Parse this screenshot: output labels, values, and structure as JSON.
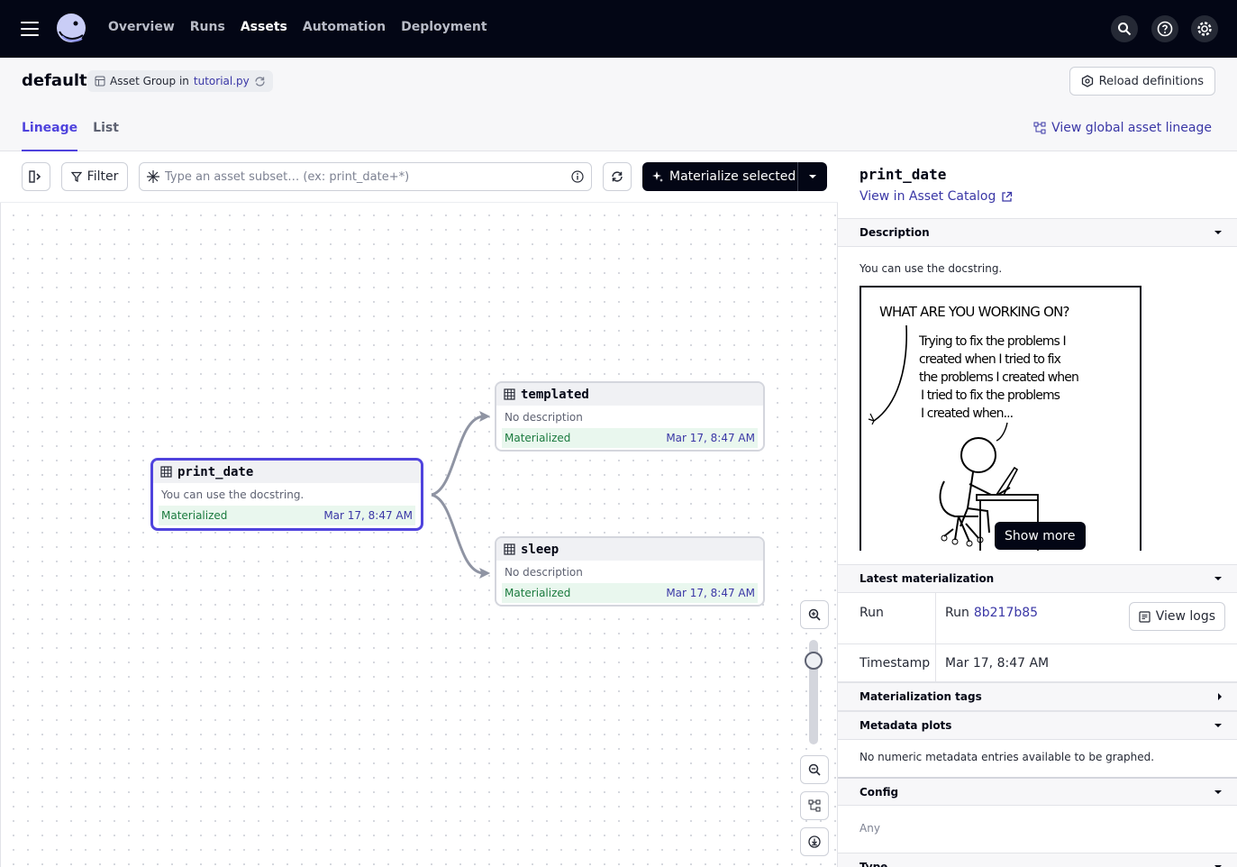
{
  "nav": {
    "links": [
      "Overview",
      "Runs",
      "Assets",
      "Automation",
      "Deployment"
    ],
    "active": "Assets",
    "icons": [
      "search-icon",
      "help-icon",
      "settings-icon"
    ]
  },
  "header": {
    "title": "default",
    "group_tag_prefix": "Asset Group in",
    "group_tag_file": "tutorial.py",
    "reload_label": "Reload definitions",
    "tabs": [
      "Lineage",
      "List"
    ],
    "active_tab": "Lineage",
    "global_lineage_label": "View global asset lineage"
  },
  "toolbar": {
    "filter_label": "Filter",
    "search_placeholder": "Type an asset subset… (ex: print_date+*)",
    "materialize_label": "Materialize selected"
  },
  "graph": {
    "nodes": [
      {
        "name": "print_date",
        "description": "You can use the docstring.",
        "status": "Materialized",
        "timestamp": "Mar 17, 8:47 AM",
        "selected": true
      },
      {
        "name": "templated",
        "description": "No description",
        "status": "Materialized",
        "timestamp": "Mar 17, 8:47 AM",
        "selected": false
      },
      {
        "name": "sleep",
        "description": "No description",
        "status": "Materialized",
        "timestamp": "Mar 17, 8:47 AM",
        "selected": false
      }
    ],
    "edges": [
      [
        "print_date",
        "templated"
      ],
      [
        "print_date",
        "sleep"
      ]
    ]
  },
  "side": {
    "title": "print_date",
    "catalog_link": "View in Asset Catalog",
    "sections": {
      "description": "Description",
      "latest_materialization": "Latest materialization",
      "materialization_tags": "Materialization tags",
      "metadata_plots": "Metadata plots",
      "config": "Config",
      "type": "Type"
    },
    "description_text": "You can use the docstring.",
    "comic": {
      "line1": "What are you working on?",
      "line2a": "Trying to fix the problems I",
      "line2b": "created when I tried to fix",
      "line2c": "the problems I created when",
      "line2d": "I tried to fix the problems",
      "line2e": "I created when..."
    },
    "show_more": "Show more",
    "run_key": "Run",
    "run_prefix": "Run",
    "run_id": "8b217b85",
    "view_logs": "View logs",
    "timestamp_key": "Timestamp",
    "timestamp_value": "Mar 17, 8:47 AM",
    "metadata_empty": "No numeric metadata entries available to be graphed.",
    "config_value": "Any"
  },
  "colors": {
    "accent": "#4f43dd",
    "link": "#3a37a6",
    "nav_bg": "#030615",
    "success": "#1a7a3e"
  }
}
